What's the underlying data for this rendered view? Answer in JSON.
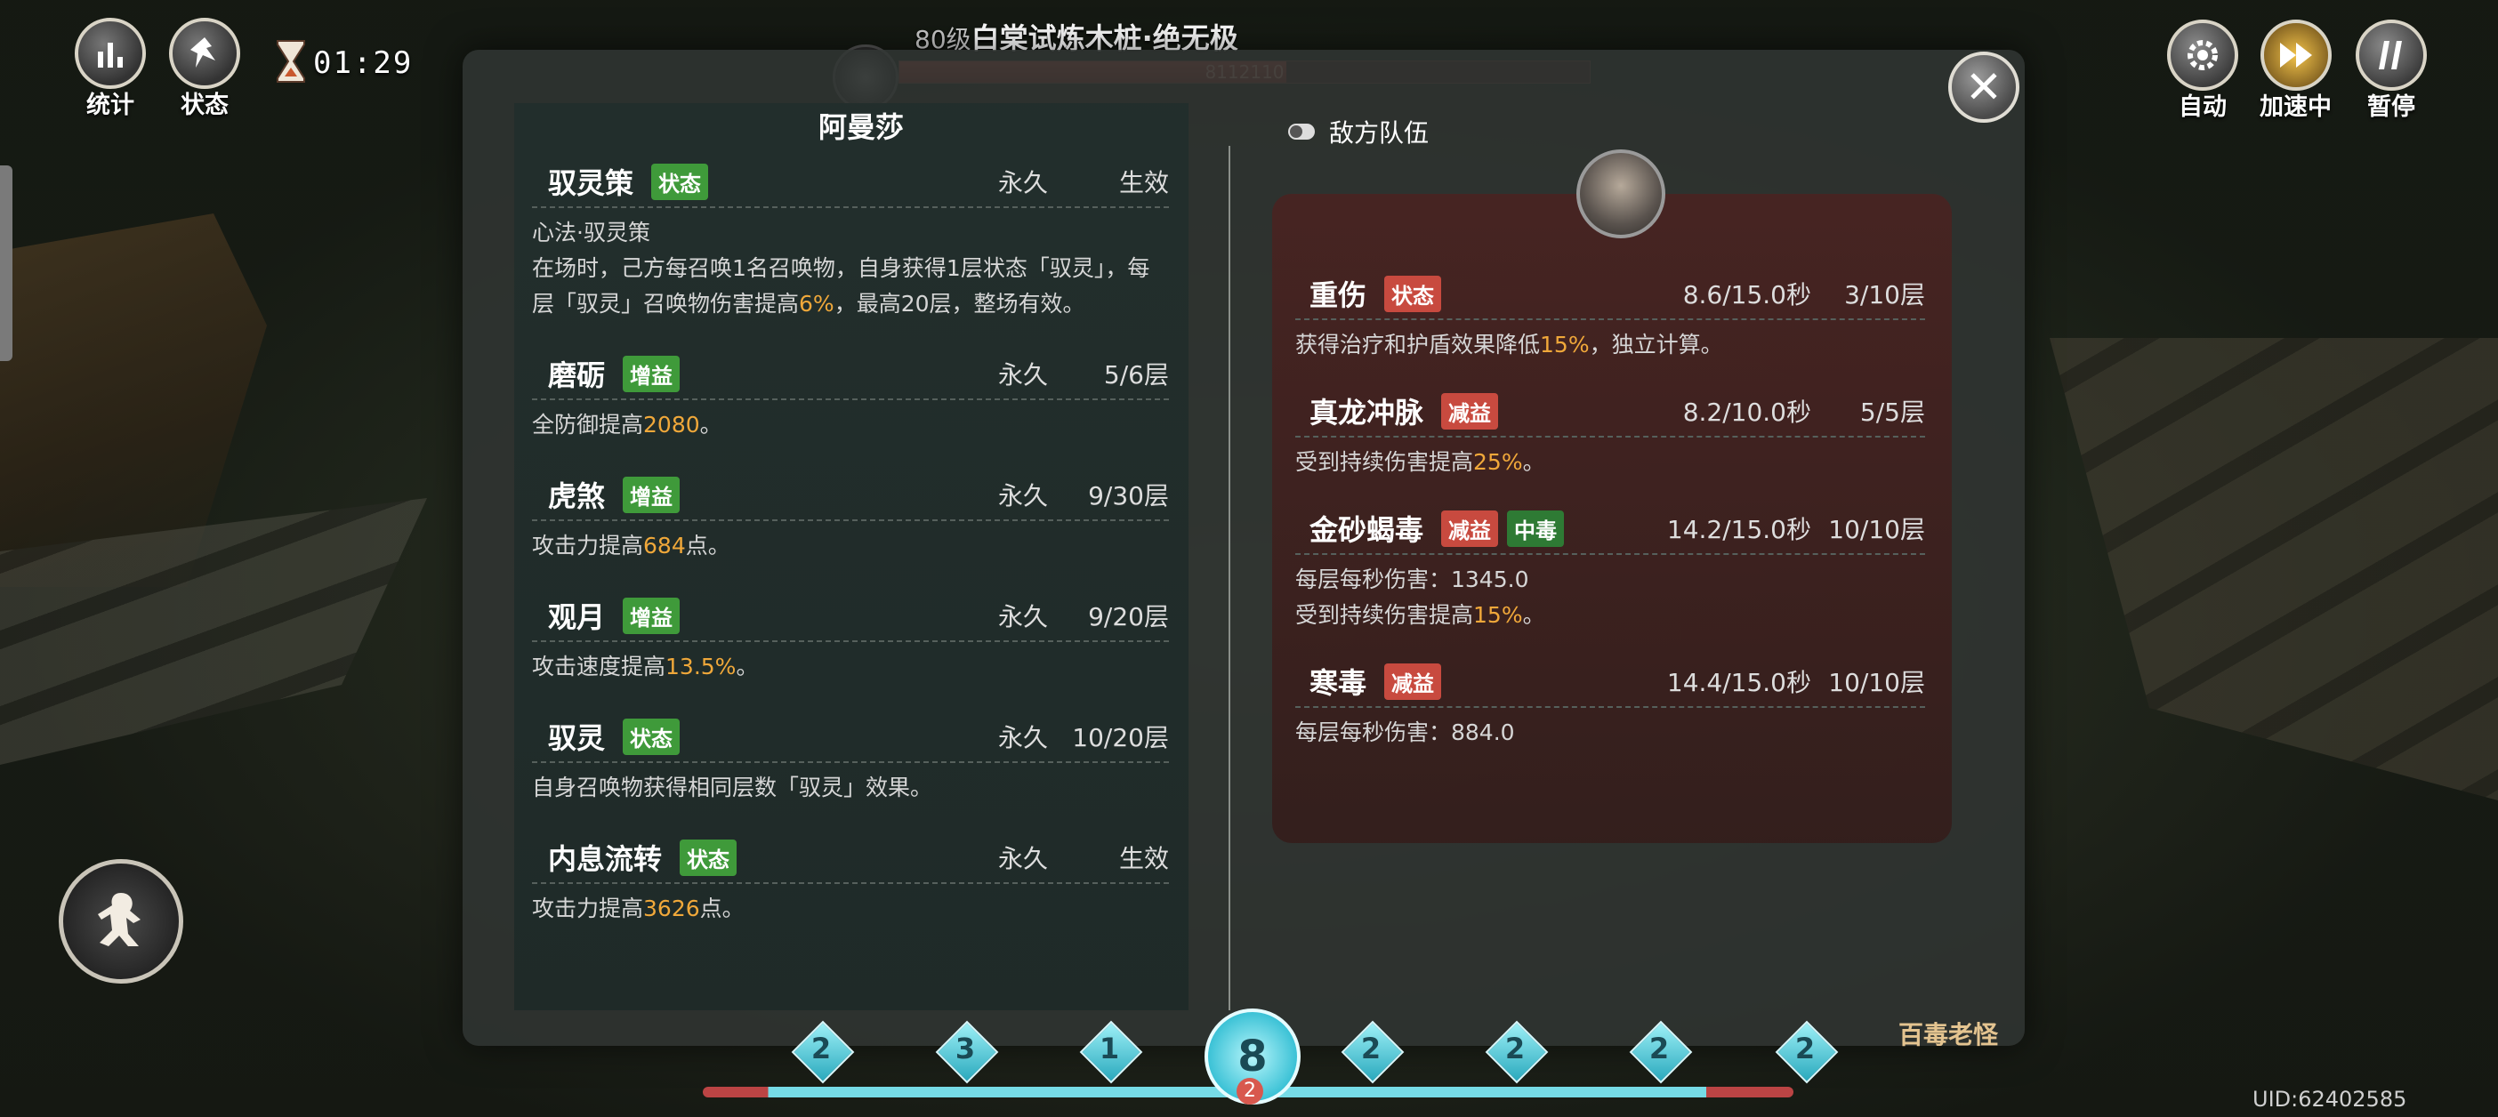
{
  "hud": {
    "stats_label": "统计",
    "status_label": "状态",
    "timer": "01:29",
    "auto_label": "自动",
    "speed_label": "加速中",
    "pause_label": "暂停"
  },
  "boss": {
    "level": "80级",
    "name": "白棠试炼木桩·绝无极",
    "hp_text": "8112110",
    "hp_fraction": 0.56
  },
  "ally": {
    "name": "阿曼莎",
    "buffs": [
      {
        "name": "驭灵策",
        "tag": "状态",
        "duration": "永久",
        "stack": "生效",
        "desc_parts": [
          {
            "t": "心法·驭灵策"
          },
          {
            "br": true
          },
          {
            "t": "在场时，己方每召唤1名召唤物，自身获得1层状态「驭灵」，每层「驭灵」召唤物伤害提高"
          },
          {
            "t": "6%",
            "hl": true
          },
          {
            "t": "，最高20层，整场有效。"
          }
        ]
      },
      {
        "name": "磨砺",
        "tag": "增益",
        "duration": "永久",
        "stack": "5/6层",
        "desc_parts": [
          {
            "t": "全防御提高"
          },
          {
            "t": "2080",
            "hl": true
          },
          {
            "t": "。"
          }
        ]
      },
      {
        "name": "虎煞",
        "tag": "增益",
        "duration": "永久",
        "stack": "9/30层",
        "desc_parts": [
          {
            "t": "攻击力提高"
          },
          {
            "t": "684",
            "hl": true
          },
          {
            "t": "点。"
          }
        ]
      },
      {
        "name": "观月",
        "tag": "增益",
        "duration": "永久",
        "stack": "9/20层",
        "desc_parts": [
          {
            "t": "攻击速度提高"
          },
          {
            "t": "13.5%",
            "hl": true
          },
          {
            "t": "。"
          }
        ]
      },
      {
        "name": "驭灵",
        "tag": "状态",
        "duration": "永久",
        "stack": "10/20层",
        "desc_parts": [
          {
            "t": "自身召唤物获得相同层数「驭灵」效果。"
          }
        ]
      },
      {
        "name": "内息流转",
        "tag": "状态",
        "duration": "永久",
        "stack": "生效",
        "desc_parts": [
          {
            "t": "攻击力提高"
          },
          {
            "t": "3626",
            "hl": true
          },
          {
            "t": "点。"
          }
        ]
      }
    ]
  },
  "enemy": {
    "header": "敌方队伍",
    "debuffs": [
      {
        "name": "重伤",
        "tags": [
          {
            "label": "状态",
            "color": "red"
          }
        ],
        "duration": "8.6/15.0秒",
        "stack": "3/10层",
        "desc_parts": [
          {
            "t": "获得治疗和护盾效果降低"
          },
          {
            "t": "15%",
            "hl": true
          },
          {
            "t": "，独立计算。"
          }
        ]
      },
      {
        "name": "真龙冲脉",
        "tags": [
          {
            "label": "减益",
            "color": "red"
          }
        ],
        "duration": "8.2/10.0秒",
        "stack": "5/5层",
        "desc_parts": [
          {
            "t": "受到持续伤害提高"
          },
          {
            "t": "25%",
            "hl": true
          },
          {
            "t": "。"
          }
        ]
      },
      {
        "name": "金砂蝎毒",
        "tags": [
          {
            "label": "减益",
            "color": "red"
          },
          {
            "label": "中毒",
            "color": "dgreen"
          }
        ],
        "duration": "14.2/15.0秒",
        "stack": "10/10层",
        "desc_parts": [
          {
            "t": "每层每秒伤害：1345.0"
          },
          {
            "br": true
          },
          {
            "t": "受到持续伤害提高"
          },
          {
            "t": "15%",
            "hl": true
          },
          {
            "t": "。"
          }
        ]
      },
      {
        "name": "寒毒",
        "tags": [
          {
            "label": "减益",
            "color": "red"
          }
        ],
        "duration": "14.4/15.0秒",
        "stack": "10/10层",
        "desc_parts": [
          {
            "t": "每层每秒伤害：884.0"
          }
        ]
      }
    ]
  },
  "bottom": {
    "gems_left": [
      "2",
      "3",
      "1"
    ],
    "center": "8",
    "center_sub": "2",
    "gems_right": [
      "2",
      "2",
      "2",
      "2"
    ],
    "boss_name": "百毒老怪",
    "uid": "UID:62402585"
  },
  "colors": {
    "tag_green": "#3f9a3a",
    "tag_red": "#c84a3f",
    "highlight": "#f0a83a",
    "mana": "#76dbe6"
  }
}
